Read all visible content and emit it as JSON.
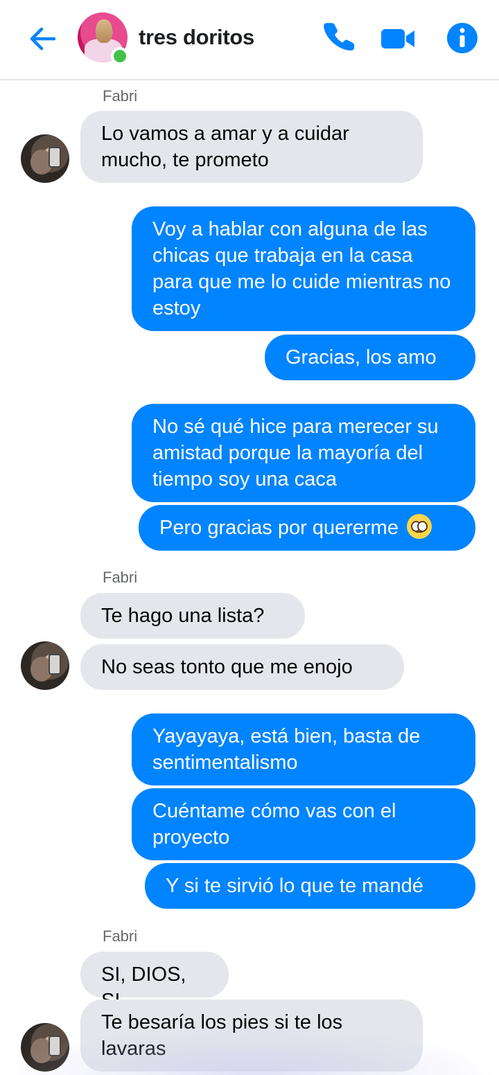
{
  "header": {
    "contact_name": "tres doritos",
    "back_icon": "arrow-left-icon",
    "call_icon": "phone-icon",
    "video_icon": "video-camera-icon",
    "info_icon": "info-icon",
    "online_status_color": "#44c04a",
    "accent_color": "#0084ff"
  },
  "messages": [
    {
      "sender_label": "Fabri"
    },
    {
      "text": "Lo vamos a amar y a cuidar mucho, te prometo",
      "direction": "in"
    },
    {
      "text": "Voy a hablar con alguna de las chicas que trabaja en la casa para que me lo cuide mientras no estoy",
      "direction": "out"
    },
    {
      "text": "Gracias, los amo",
      "direction": "out"
    },
    {
      "text": "No sé qué hice para merecer su amistad porque la mayoría del tiempo soy una caca",
      "direction": "out"
    },
    {
      "text": "Pero gracias por quererme",
      "direction": "out",
      "emoji": "pleading-face-icon"
    },
    {
      "sender_label": "Fabri"
    },
    {
      "text": "Te hago una lista?",
      "direction": "in"
    },
    {
      "text": "No seas tonto que me enojo",
      "direction": "in"
    },
    {
      "text": "Yayayaya, está bien, basta de sentimentalismo",
      "direction": "out"
    },
    {
      "text": "Cuéntame cómo vas con el proyecto",
      "direction": "out"
    },
    {
      "text": "Y si te sirvió lo que te mandé",
      "direction": "out"
    },
    {
      "sender_label": "Fabri"
    },
    {
      "text": "SI, DIOS, SI",
      "direction": "in"
    },
    {
      "text": "Te besaría los pies si te los lavaras",
      "direction": "in"
    }
  ],
  "colors": {
    "incoming_bubble": "#e4e6eb",
    "outgoing_bubble": "#0084ff",
    "sender_label": "#65676b"
  }
}
